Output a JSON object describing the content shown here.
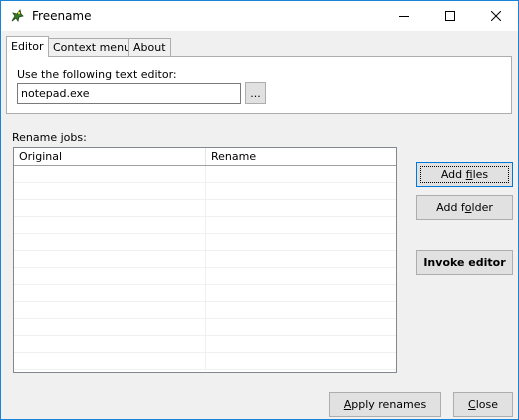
{
  "window": {
    "title": "Freename"
  },
  "tabs": [
    {
      "label": "Editor"
    },
    {
      "label": "Context menu"
    },
    {
      "label": "About"
    }
  ],
  "editor": {
    "label": "Use the following text editor:",
    "value": "notepad.exe",
    "browse_label": "..."
  },
  "jobs": {
    "label": "Rename jobs:",
    "columns": [
      "Original",
      "Rename"
    ],
    "rows": []
  },
  "buttons": {
    "add_files": {
      "pre": "Add ",
      "ul": "f",
      "post": "iles"
    },
    "add_folder": {
      "pre": "Add f",
      "ul": "o",
      "post": "lder"
    },
    "invoke_editor": "Invoke editor",
    "apply_renames": {
      "pre": "",
      "ul": "A",
      "post": "pply renames"
    },
    "close": {
      "pre": "",
      "ul": "C",
      "post": "lose"
    }
  }
}
